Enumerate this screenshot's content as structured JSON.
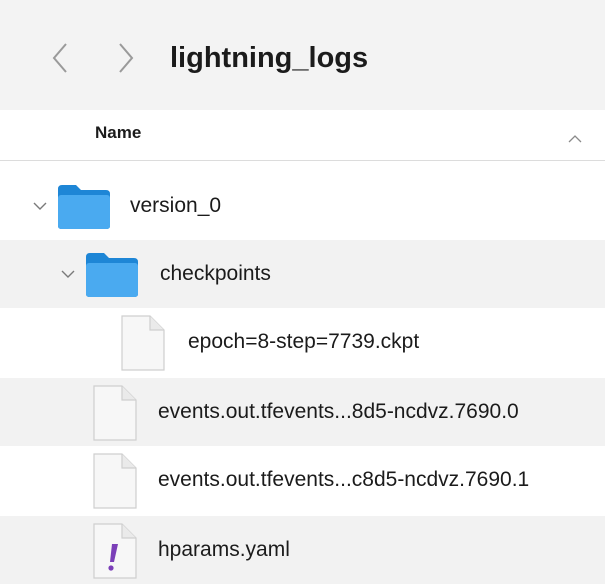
{
  "window": {
    "title": "lightning_logs"
  },
  "nav": {
    "back_icon": "chevron-left-icon",
    "forward_icon": "chevron-right-icon"
  },
  "columns": {
    "name_header": "Name",
    "sort_icon": "chevron-up-icon"
  },
  "items": [
    {
      "name": "version_0",
      "kind": "folder",
      "expanded": true,
      "depth": 0
    },
    {
      "name": "checkpoints",
      "kind": "folder",
      "expanded": true,
      "depth": 1
    },
    {
      "name": "epoch=8-step=7739.ckpt",
      "kind": "file",
      "depth": 2
    },
    {
      "name": "events.out.tfevents...8d5-ncdvz.7690.0",
      "kind": "file",
      "depth": 1
    },
    {
      "name": "events.out.tfevents...c8d5-ncdvz.7690.1",
      "kind": "file",
      "depth": 1
    },
    {
      "name": "hparams.yaml",
      "kind": "yaml-file",
      "depth": 1
    }
  ],
  "colors": {
    "folder": "#3aa0e8",
    "yaml_mark": "#7b3fb8",
    "alt_row": "#f2f2f2"
  }
}
